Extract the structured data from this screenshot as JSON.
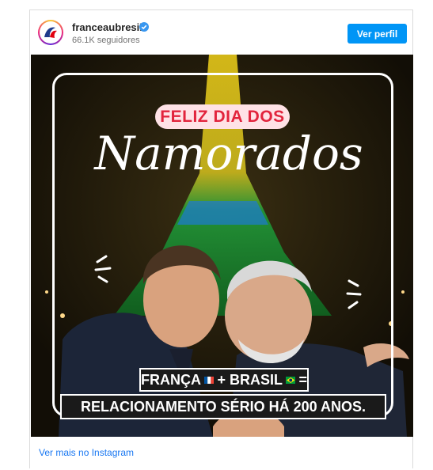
{
  "post": {
    "username": "franceaubresil",
    "followers": "66.1K seguidores",
    "follow_button": "Ver perfil",
    "footer_link": "Ver mais no Instagram"
  },
  "image": {
    "pill_text": "FELIZ DIA DOS",
    "script_text": "Namorados",
    "caption_line1_a": "FRANÇA",
    "caption_line1_b": "+ BRASIL",
    "caption_line1_c": "=",
    "caption_line2": "RELACIONAMENTO SÉRIO HÁ 200 ANOS."
  },
  "colors": {
    "button": "#0095f6",
    "link": "#1877f2",
    "pill_bg": "#ffe2e6",
    "pill_text": "#e2243d",
    "tower_green": "#1fa23c",
    "tower_yellow": "#f2d21a"
  }
}
